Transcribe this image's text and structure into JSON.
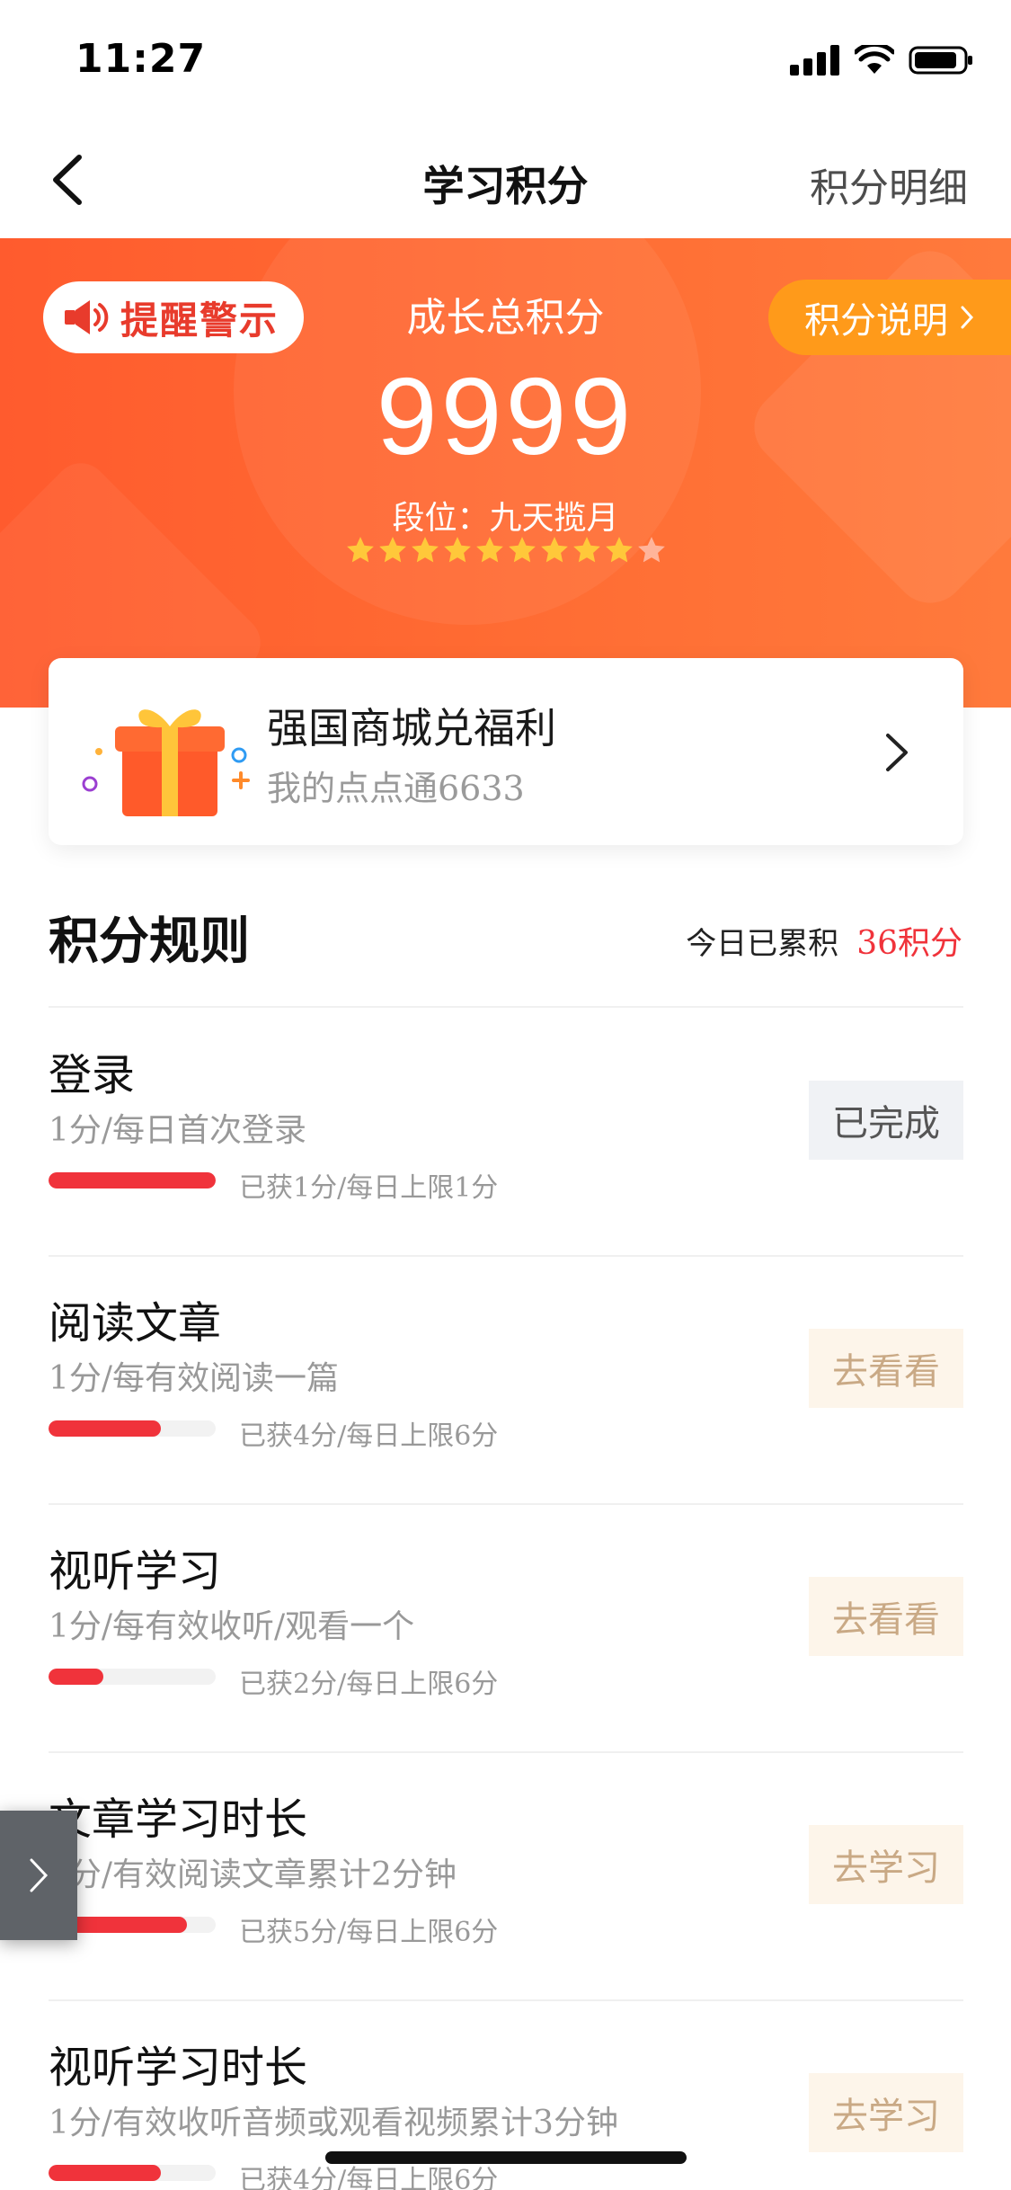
{
  "status_bar": {
    "time": "11:27"
  },
  "nav": {
    "title": "学习积分",
    "right_label": "积分明细"
  },
  "hero": {
    "remind_label": "提醒警示",
    "rule_label": "积分说明",
    "total_label": "成长总积分",
    "total_score": "9999",
    "level_text": "段位：九天揽月",
    "stars_filled": 9,
    "stars_total": 10
  },
  "mall": {
    "title": "强国商城兑福利",
    "subtitle": "我的点点通6633"
  },
  "rules": {
    "title": "积分规则",
    "today_label": "今日已累积",
    "today_value": "36积分",
    "tasks": [
      {
        "name": "登录",
        "desc": "1分/每日首次登录",
        "progress_text": "已获1分/每日上限1分",
        "progress": 1.0,
        "button": "已完成",
        "done": true
      },
      {
        "name": "阅读文章",
        "desc": "1分/每有效阅读一篇",
        "progress_text": "已获4分/每日上限6分",
        "progress": 0.67,
        "button": "去看看",
        "done": false
      },
      {
        "name": "视听学习",
        "desc": "1分/每有效收听/观看一个",
        "progress_text": "已获2分/每日上限6分",
        "progress": 0.33,
        "button": "去看看",
        "done": false
      },
      {
        "name": "文章学习时长",
        "desc": "1分/有效阅读文章累计2分钟",
        "progress_text": "已获5分/每日上限6分",
        "progress": 0.83,
        "button": "去学习",
        "done": false
      },
      {
        "name": "视听学习时长",
        "desc": "1分/有效收听音频或观看视频累计3分钟",
        "progress_text": "已获4分/每日上限6分",
        "progress": 0.67,
        "button": "去学习",
        "done": false
      }
    ]
  },
  "colors": {
    "accent": "#f0333b",
    "hero": "#ff6a32",
    "pill": "#ff9a1a"
  },
  "icons": [
    "back-icon",
    "signal-icon",
    "wifi-icon",
    "battery-icon",
    "speaker-icon",
    "gift-icon",
    "chevron-right-icon",
    "star-icon"
  ]
}
